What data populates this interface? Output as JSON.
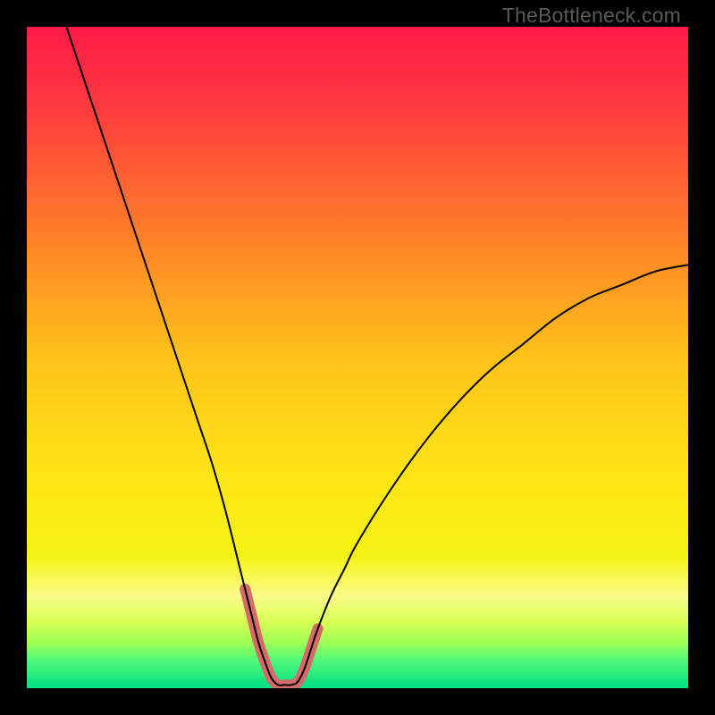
{
  "watermark": "TheBottleneck.com",
  "chart_data": {
    "type": "line",
    "title": "",
    "xlabel": "",
    "ylabel": "",
    "xlim": [
      0,
      100
    ],
    "ylim": [
      0,
      100
    ],
    "background_gradient_stops": [
      {
        "offset": 0.0,
        "color": "#ff1a47"
      },
      {
        "offset": 0.12,
        "color": "#ff3a3f"
      },
      {
        "offset": 0.3,
        "color": "#ff7a2a"
      },
      {
        "offset": 0.5,
        "color": "#ffc21a"
      },
      {
        "offset": 0.68,
        "color": "#ffe516"
      },
      {
        "offset": 0.8,
        "color": "#f4f314"
      },
      {
        "offset": 0.86,
        "color": "#fbfb8a"
      },
      {
        "offset": 0.9,
        "color": "#d7ff55"
      },
      {
        "offset": 0.93,
        "color": "#9fff55"
      },
      {
        "offset": 0.96,
        "color": "#4cf77a"
      },
      {
        "offset": 1.0,
        "color": "#00e083"
      }
    ],
    "series": [
      {
        "name": "bottleneck-curve",
        "color": "#000000",
        "width": 2,
        "x": [
          6,
          8,
          10,
          12,
          14,
          16,
          18,
          20,
          22,
          24,
          26,
          28,
          30,
          32,
          33,
          34,
          35,
          36,
          37,
          38,
          39,
          40,
          41,
          42,
          43,
          44,
          46,
          48,
          50,
          55,
          60,
          65,
          70,
          75,
          80,
          85,
          90,
          95,
          100
        ],
        "y": [
          100,
          94,
          88,
          82,
          76,
          70,
          64,
          58,
          52,
          46,
          40,
          34,
          27,
          19,
          15,
          11,
          7,
          4,
          1.5,
          0.5,
          0.5,
          0.5,
          1.0,
          3,
          6,
          9,
          14,
          18,
          22,
          30,
          37,
          43,
          48,
          52,
          56,
          59,
          61,
          63,
          64
        ]
      },
      {
        "name": "highlight-band",
        "color": "#d66a6a",
        "width": 12,
        "linecap": "round",
        "x": [
          33.0,
          34.0,
          35.0,
          36.0,
          37.0,
          38.0,
          39.0,
          40.0,
          41.0,
          42.0,
          43.0,
          44.0
        ],
        "y": [
          15.0,
          11.0,
          7.0,
          4.0,
          1.5,
          0.5,
          0.5,
          0.5,
          1.0,
          3.0,
          6.0,
          9.0
        ]
      }
    ]
  }
}
